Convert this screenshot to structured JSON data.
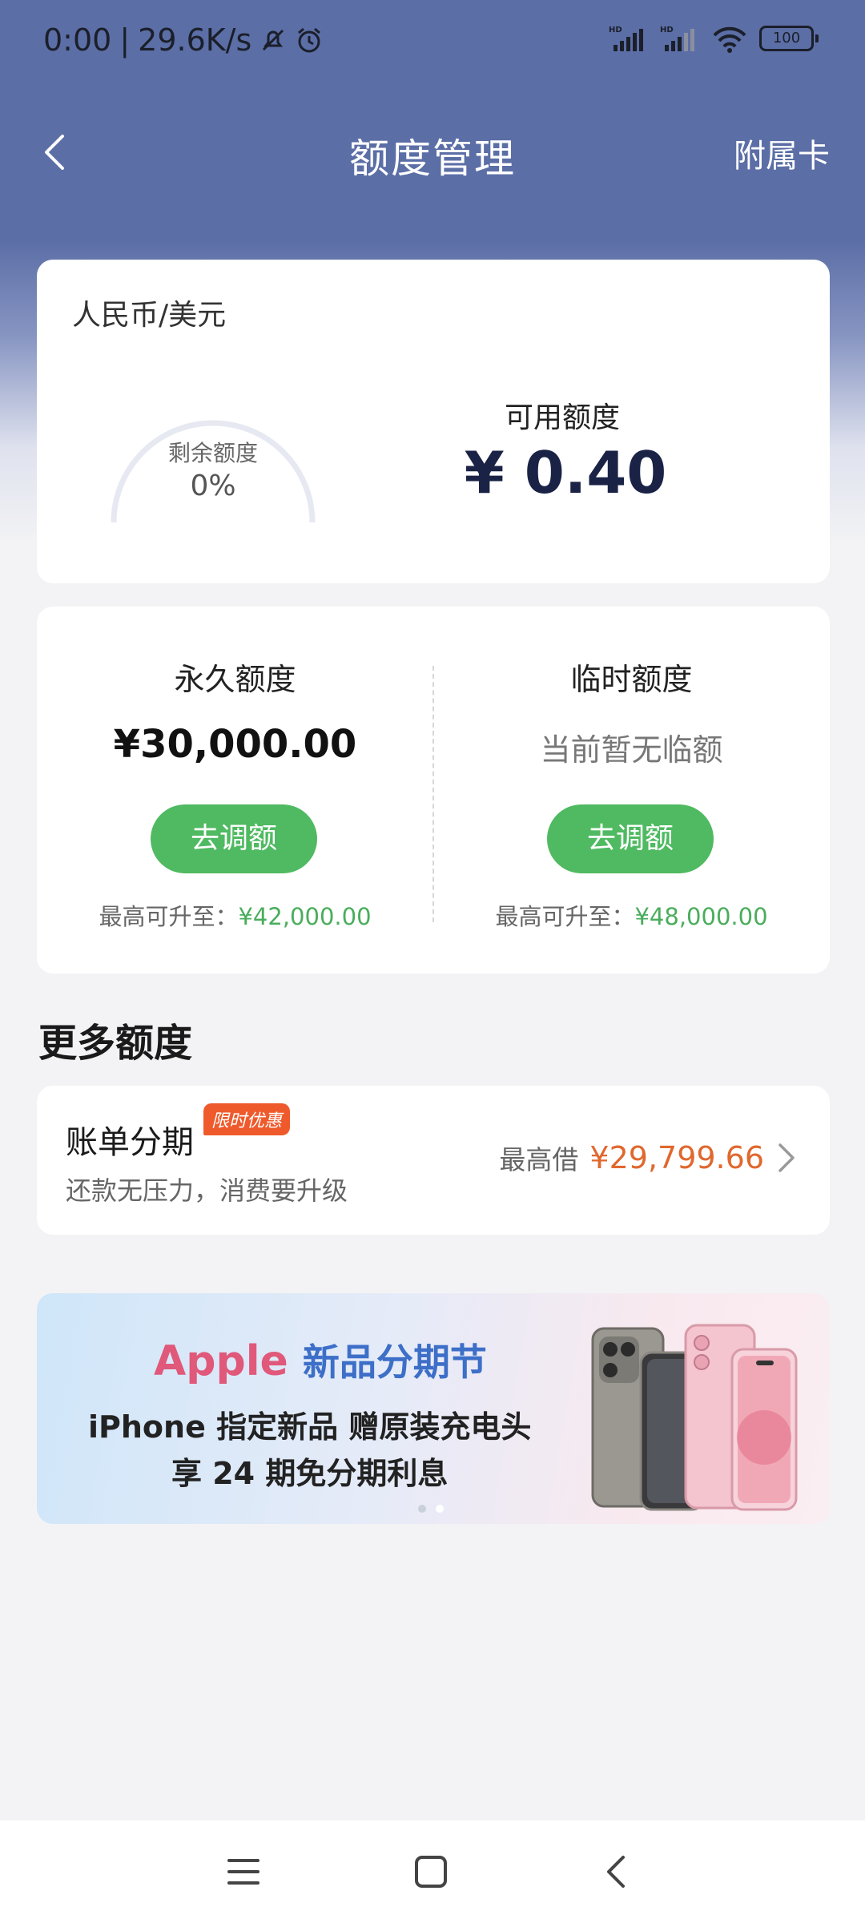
{
  "status_bar": {
    "time": "0:00",
    "network_speed": "29.6K/s",
    "battery": "100",
    "icons": [
      "mute-bell-icon",
      "alarm-icon",
      "hd-signal-icon",
      "hd-signal-icon",
      "wifi-icon",
      "battery-icon"
    ]
  },
  "nav": {
    "title": "额度管理",
    "right_link": "附属卡",
    "back_icon": "chevron-left-icon"
  },
  "available_card": {
    "currency": "人民币/美元",
    "gauge_label": "剩余额度",
    "gauge_value": "0%",
    "gauge_fraction": 0,
    "title": "可用额度",
    "amount": "¥ 0.40"
  },
  "limits": {
    "permanent": {
      "title": "永久额度",
      "amount": "¥30,000.00",
      "button": "去调额",
      "max_label": "最高可升至：",
      "max_value": "¥42,000.00"
    },
    "temporary": {
      "title": "临时额度",
      "note": "当前暂无临额",
      "button": "去调额",
      "max_label": "最高可升至：",
      "max_value": "¥48,000.00"
    }
  },
  "more": {
    "section_title": "更多额度",
    "installment": {
      "title": "账单分期",
      "badge": "限时优惠",
      "subtitle": "还款无压力，消费要升级",
      "max_label": "最高借",
      "max_amount": "¥29,799.66"
    }
  },
  "banner": {
    "brand": "Apple",
    "headline": "新品分期节",
    "line1": "iPhone 指定新品 赠原装充电头",
    "line2": "享 24 期免分期利息",
    "pages": 2,
    "active_page": 2
  },
  "system_nav": {
    "icons": [
      "menu-icon",
      "home-square-icon",
      "back-chevron-icon"
    ]
  },
  "colors": {
    "header_blue": "#5b6ea6",
    "green": "#4fba61",
    "orange": "#e0682e",
    "badge_orange": "#ef5a2c"
  }
}
